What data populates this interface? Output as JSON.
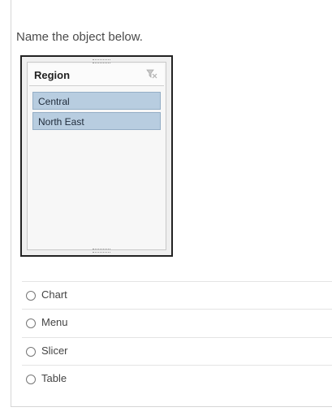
{
  "question": {
    "text": "Name the object below."
  },
  "slicer": {
    "title": "Region",
    "items": [
      {
        "label": "Central"
      },
      {
        "label": "North East"
      }
    ],
    "clear_icon": "filter-clear-icon",
    "item_color": "#b8cde0"
  },
  "options": [
    {
      "label": "Chart"
    },
    {
      "label": "Menu"
    },
    {
      "label": "Slicer"
    },
    {
      "label": "Table"
    }
  ]
}
